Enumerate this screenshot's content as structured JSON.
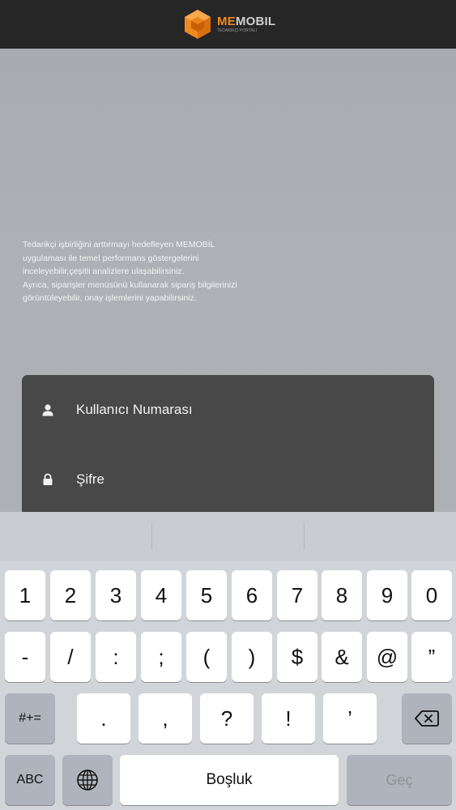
{
  "header": {
    "logo_me": "ME",
    "logo_mobil": "MOBIL",
    "logo_tagline": "TEDARİKÇİ PORTALI"
  },
  "intro": {
    "lines": [
      "Tedarikçi işbirliğini arttırmayı hedefleyen MEMOBİL",
      " uygulaması ile temel performans göstergelerini",
      " inceleyebilir,çeşitli analizlere ulaşabilirsiniz.",
      "Ayrıca, siparişler menüsünü kullanarak sipariş bilgilerinizi",
      " görüntüleyebilir, onay işlemlerini yapabilirsiniz."
    ]
  },
  "login": {
    "user_placeholder": "Kullanıcı Numarası",
    "password_placeholder": "Şifre",
    "user_icon": "user-icon",
    "lock_icon": "lock-icon"
  },
  "keyboard": {
    "row1": [
      "1",
      "2",
      "3",
      "4",
      "5",
      "6",
      "7",
      "8",
      "9",
      "0"
    ],
    "row2": [
      "-",
      "/",
      ":",
      ";",
      "(",
      ")",
      "$",
      "&",
      "@",
      "”"
    ],
    "row3_mode": "#+=",
    "row3": [
      ".",
      ",",
      "?",
      "!",
      "’"
    ],
    "abc": "ABC",
    "space": "Boşluk",
    "go": "Geç",
    "globe_icon": "globe-icon",
    "backspace_icon": "backspace-icon"
  },
  "colors": {
    "brand_orange": "#f08a1f",
    "top_bar": "#262626",
    "panel": "#484848",
    "keyboard_bg": "#d1d4d9"
  }
}
